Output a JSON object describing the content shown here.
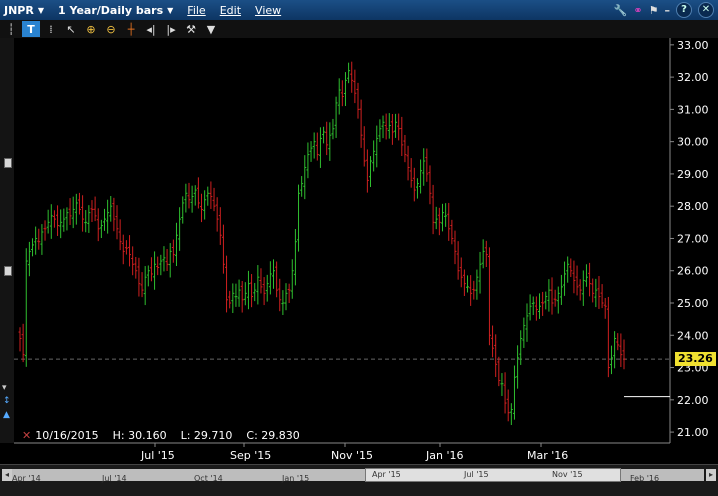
{
  "titlebar": {
    "symbol": "JNPR",
    "period": "1 Year/Daily bars",
    "menus": [
      "File",
      "Edit",
      "View"
    ]
  },
  "toolbar": {
    "tools": [
      "text-tool",
      "crosshair",
      "pointer",
      "zoom-in",
      "zoom-out",
      "crosshair-cursor",
      "bar-cursor-left",
      "bar-cursor-right",
      "settings",
      "more"
    ]
  },
  "info": {
    "date": "10/16/2015",
    "high": "H: 30.160",
    "low": "L: 29.710",
    "close": "C: 29.830"
  },
  "last_price": "23.26",
  "navigator": {
    "labels": [
      "Apr '14",
      "Jul '14",
      "Oct '14",
      "Jan '15",
      "Apr '15",
      "Jul '15",
      "Nov '15",
      "Feb '16"
    ]
  },
  "chart_data": {
    "type": "candlestick",
    "y_ticks": [
      "33.00",
      "32.00",
      "31.00",
      "30.00",
      "29.00",
      "28.00",
      "27.00",
      "26.00",
      "25.00",
      "24.00",
      "23.00",
      "22.00",
      "21.00"
    ],
    "ylim": [
      20.5,
      33.2
    ],
    "x_ticks": [
      "Jul '15",
      "Sep '15",
      "Nov '15",
      "Jan '16",
      "Mar '16"
    ],
    "colors": {
      "up": "#2fbf2f",
      "down": "#d02020",
      "axis_text": "#ffffff",
      "price_tag": "#f0e030"
    },
    "closes": [
      23.9,
      23.4,
      26.3,
      26.6,
      26.8,
      27.0,
      26.9,
      27.2,
      27.3,
      27.5,
      27.7,
      27.6,
      27.4,
      27.5,
      27.6,
      27.8,
      27.7,
      27.9,
      28.1,
      27.9,
      27.6,
      27.5,
      27.8,
      27.9,
      27.7,
      27.3,
      27.4,
      27.6,
      27.8,
      28.0,
      27.6,
      27.3,
      26.9,
      26.6,
      26.7,
      26.5,
      26.2,
      26.0,
      25.6,
      25.4,
      25.8,
      26.0,
      25.9,
      26.2,
      26.1,
      26.3,
      26.4,
      26.2,
      26.6,
      26.5,
      27.1,
      27.6,
      28.1,
      28.4,
      28.2,
      28.3,
      28.5,
      28.1,
      27.9,
      28.2,
      28.4,
      28.3,
      28.0,
      27.6,
      27.1,
      26.2,
      25.1,
      25.0,
      25.3,
      25.2,
      25.4,
      25.1,
      25.3,
      25.6,
      25.2,
      25.4,
      25.8,
      25.5,
      25.3,
      25.6,
      25.9,
      26.0,
      25.4,
      25.1,
      25.0,
      25.3,
      25.4,
      26.0,
      26.9,
      28.4,
      28.7,
      29.2,
      29.6,
      29.8,
      30.0,
      29.6,
      30.1,
      30.3,
      29.9,
      30.2,
      30.4,
      31.2,
      31.6,
      31.4,
      31.9,
      32.2,
      31.9,
      31.5,
      31.0,
      30.2,
      29.4,
      28.8,
      29.4,
      29.7,
      30.1,
      30.4,
      30.6,
      30.4,
      30.5,
      30.3,
      30.6,
      30.4,
      29.9,
      29.6,
      29.2,
      28.8,
      28.5,
      28.7,
      29.1,
      29.4,
      29.0,
      28.4,
      27.5,
      27.6,
      27.5,
      27.8,
      27.7,
      27.3,
      27.0,
      26.6,
      26.0,
      25.8,
      25.6,
      25.5,
      25.3,
      25.4,
      25.8,
      26.2,
      26.6,
      26.5,
      24.0,
      23.6,
      23.1,
      22.6,
      22.5,
      21.9,
      21.6,
      21.7,
      22.7,
      23.3,
      23.9,
      24.3,
      24.6,
      24.9,
      25.0,
      24.8,
      24.9,
      25.0,
      25.2,
      25.4,
      25.0,
      25.1,
      25.3,
      25.5,
      25.9,
      26.2,
      26.0,
      25.7,
      25.5,
      25.4,
      25.7,
      25.8,
      25.6,
      25.3,
      25.4,
      25.2,
      25.0,
      24.9,
      23.0,
      23.3,
      23.9,
      23.7,
      23.4,
      23.26
    ]
  }
}
